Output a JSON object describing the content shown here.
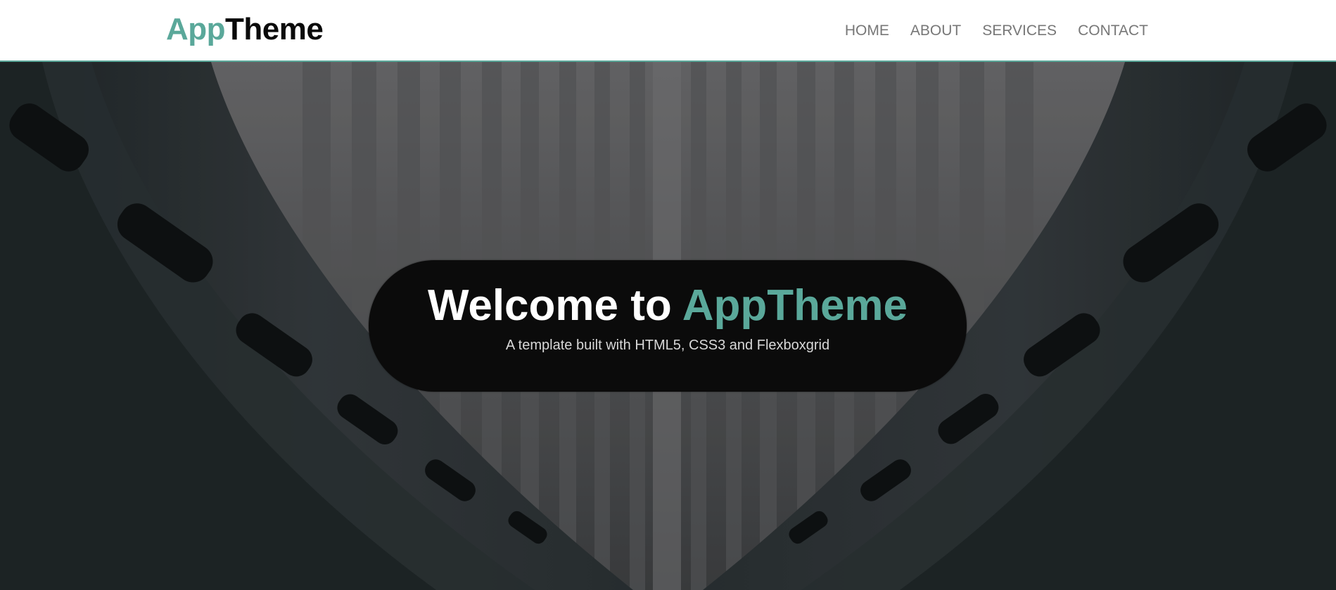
{
  "brand": {
    "logo_accent": "App",
    "logo_rest": "Theme",
    "accent_color": "#5aa89a"
  },
  "nav": {
    "items": [
      {
        "label": "HOME"
      },
      {
        "label": "ABOUT"
      },
      {
        "label": "SERVICES"
      },
      {
        "label": "CONTACT"
      }
    ]
  },
  "hero": {
    "title_prefix": "Welcome to ",
    "title_accent": "AppTheme",
    "subtitle": "A template built with HTML5, CSS3 and Flexboxgrid",
    "background": "dark architectural photo (curved concrete ribs)"
  }
}
